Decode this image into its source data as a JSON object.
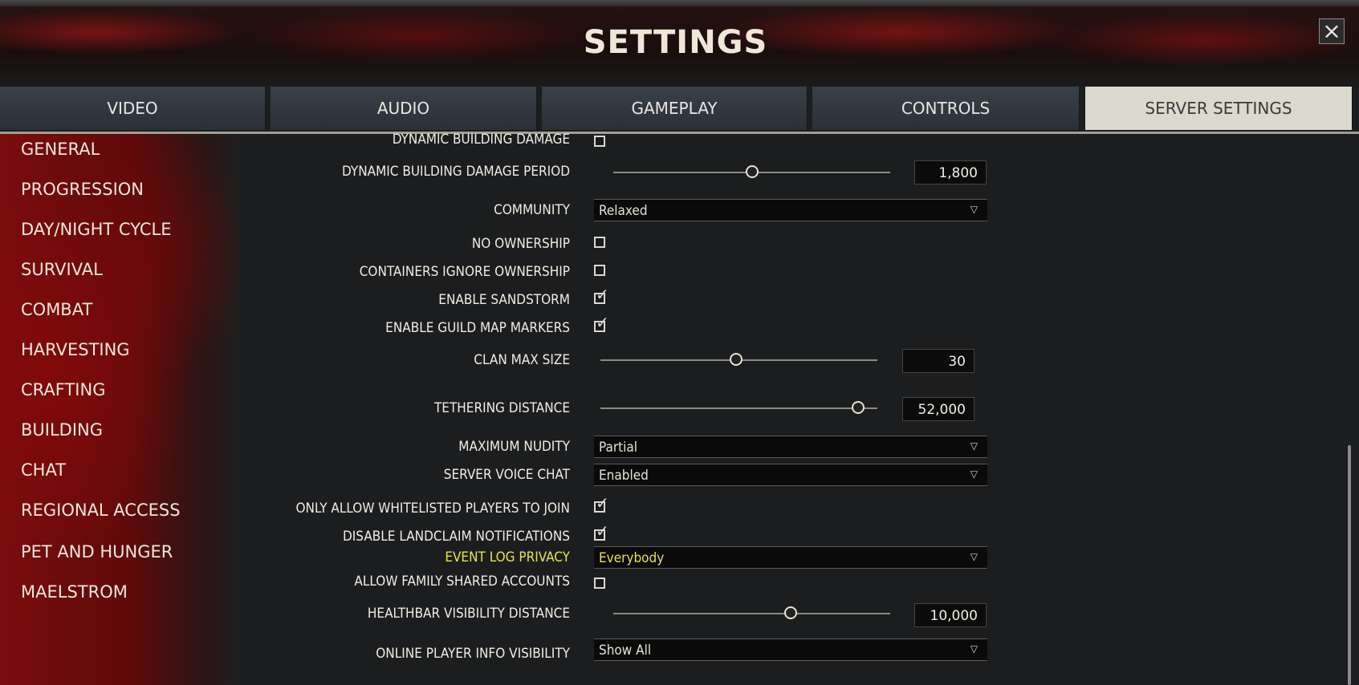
{
  "header": {
    "title": "SETTINGS",
    "close_icon": "×"
  },
  "tabs": [
    {
      "label": "VIDEO",
      "active": false
    },
    {
      "label": "AUDIO",
      "active": false
    },
    {
      "label": "GAMEPLAY",
      "active": false
    },
    {
      "label": "CONTROLS",
      "active": false
    },
    {
      "label": "SERVER SETTINGS",
      "active": true
    }
  ],
  "sidebar": {
    "items": [
      "GENERAL",
      "PROGRESSION",
      "DAY/NIGHT CYCLE",
      "SURVIVAL",
      "COMBAT",
      "HARVESTING",
      "CRAFTING",
      "BUILDING",
      "CHAT",
      "REGIONAL ACCESS",
      "PET AND HUNGER",
      "MAELSTROM"
    ]
  },
  "settings": {
    "dynamic_building_damage": {
      "label": "DYNAMIC BUILDING DAMAGE",
      "checked": false
    },
    "dynamic_building_damage_period": {
      "label": "DYNAMIC BUILDING DAMAGE PERIOD",
      "value": "1,800",
      "slider_level": 0.5
    },
    "community": {
      "label": "COMMUNITY",
      "value": "Relaxed"
    },
    "no_ownership": {
      "label": "NO OWNERSHIP",
      "checked": false
    },
    "containers_ignore_ownership": {
      "label": "CONTAINERS IGNORE OWNERSHIP",
      "checked": false
    },
    "enable_sandstorm": {
      "label": "ENABLE SANDSTORM",
      "checked": true
    },
    "enable_guild_map_markers": {
      "label": "ENABLE GUILD MAP MARKERS",
      "checked": true
    },
    "clan_max_size": {
      "label": "CLAN MAX SIZE",
      "value": "30",
      "slider_level": 0.49
    },
    "tethering_distance": {
      "label": "TETHERING DISTANCE",
      "value": "52,000",
      "slider_level": 0.93
    },
    "maximum_nudity": {
      "label": "MAXIMUM NUDITY",
      "value": "Partial"
    },
    "server_voice_chat": {
      "label": "SERVER VOICE CHAT",
      "value": "Enabled"
    },
    "whitelisted_only": {
      "label": "ONLY ALLOW WHITELISTED PLAYERS TO JOIN",
      "checked": true
    },
    "disable_landclaim_notifications": {
      "label": "DISABLE LANDCLAIM NOTIFICATIONS",
      "checked": true
    },
    "event_log_privacy": {
      "label": "EVENT LOG PRIVACY",
      "value": "Everybody"
    },
    "allow_family_shared_accounts": {
      "label": "ALLOW FAMILY SHARED ACCOUNTS",
      "checked": false
    },
    "healthbar_visibility_distance": {
      "label": "HEALTHBAR VISIBILITY DISTANCE",
      "value": "10,000",
      "slider_level": 0.64
    },
    "online_player_info_visibility": {
      "label": "ONLINE PLAYER INFO VISIBILITY",
      "value": "Show All"
    }
  },
  "colors": {
    "accent_highlight": "#e9e34a",
    "active_tab": "#dcd9cf",
    "sidebar_red": "#7a0c0c"
  }
}
